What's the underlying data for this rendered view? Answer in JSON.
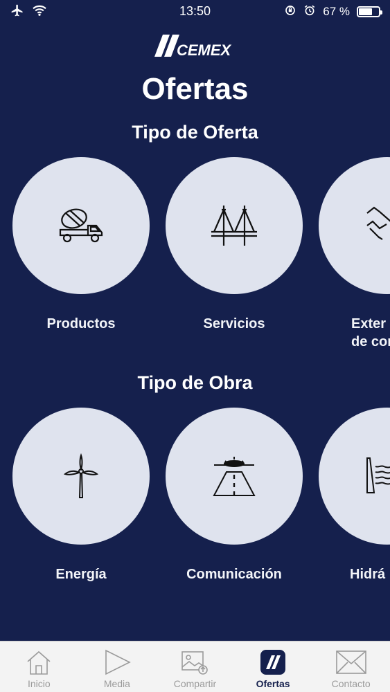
{
  "status_bar": {
    "time": "13:50",
    "battery": "67 %",
    "battery_level": 0.67,
    "icons": [
      "airplane-icon",
      "wifi-icon",
      "orientation-lock-icon",
      "alarm-icon",
      "battery-icon"
    ]
  },
  "header": {
    "logo_text": "CEMEX",
    "title": "Ofertas"
  },
  "offer_type": {
    "title": "Tipo de Oferta",
    "items": [
      {
        "label": "Productos",
        "icon": "mixer-truck-icon"
      },
      {
        "label": "Servicios",
        "icon": "bridge-icon"
      },
      {
        "label": "Exter\nde con",
        "icon": "handshake-icon"
      }
    ]
  },
  "work_type": {
    "title": "Tipo de Obra",
    "items": [
      {
        "label": "Energía",
        "icon": "wind-turbine-icon"
      },
      {
        "label": "Comunicación",
        "icon": "airport-runway-icon"
      },
      {
        "label": "Hidrá",
        "icon": "dam-icon"
      }
    ]
  },
  "tab_bar": {
    "items": [
      {
        "label": "Inicio",
        "icon": "home-icon",
        "active": false
      },
      {
        "label": "Media",
        "icon": "play-icon",
        "active": false
      },
      {
        "label": "Compartir",
        "icon": "share-image-icon",
        "active": false
      },
      {
        "label": "Ofertas",
        "icon": "cemex-offers-icon",
        "active": true
      },
      {
        "label": "Contacto",
        "icon": "mail-icon",
        "active": false
      }
    ]
  },
  "colors": {
    "background": "#15204d",
    "circle": "#dfe3ee",
    "tab_bar": "#f3f3f3",
    "tab_inactive": "#9a9a9a",
    "tab_active": "#15204d"
  }
}
